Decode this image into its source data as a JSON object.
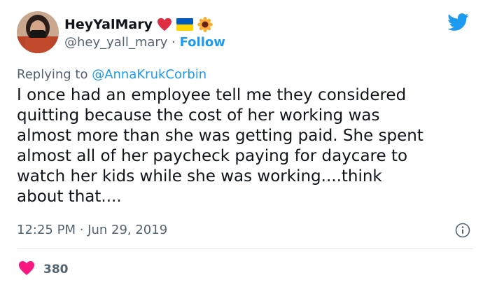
{
  "author": {
    "display_name": "HeyYalMary",
    "handle": "@hey_yall_mary",
    "separator": " · ",
    "follow_label": "Follow",
    "badges": [
      "heart-icon",
      "ukraine-flag-icon",
      "sunflower-icon"
    ]
  },
  "reply": {
    "prefix": "Replying to ",
    "mention": "@AnnaKrukCorbin"
  },
  "tweet": {
    "lines": [
      "I once had an employee tell me they considered",
      "quitting because the cost of her working was",
      "almost more than she was getting paid. She spent",
      "almost all of her paycheck paying for daycare to",
      "watch her kids while she was working....think",
      "about that...."
    ]
  },
  "meta": {
    "time": "12:25 PM",
    "separator": " · ",
    "date": "Jun 29, 2019"
  },
  "engagement": {
    "likes": "380"
  },
  "colors": {
    "accent": "#1d9bf0",
    "heart": "#f91880",
    "text": "#0f1419",
    "secondary": "#536471"
  }
}
